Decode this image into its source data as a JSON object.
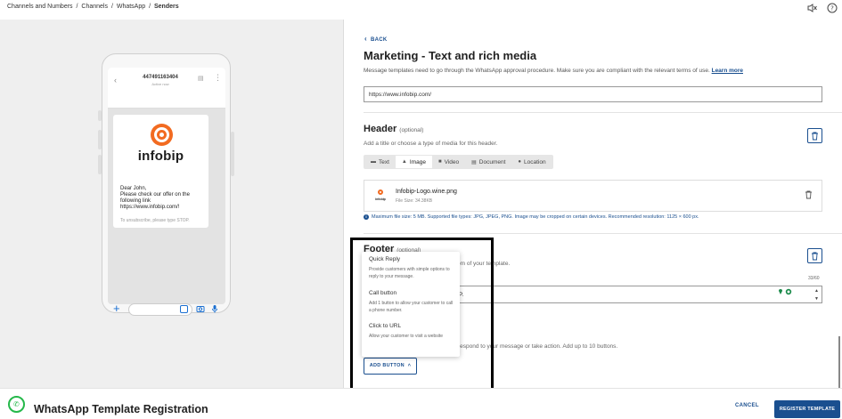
{
  "breadcrumb": {
    "items": [
      "Channels and Numbers",
      "Channels",
      "WhatsApp"
    ],
    "current": "Senders",
    "separator": "/"
  },
  "topbar": {
    "icons": [
      "mute-icon",
      "help-icon"
    ]
  },
  "preview": {
    "phone_number": "447491163404",
    "status": "Active now",
    "logo_text": "infobip",
    "message": "Dear John,\nPlease check our offer on the following link\nhttps://www.infobip.com/!",
    "footer": "To unsubscribe, please type STOP."
  },
  "form": {
    "back_label": "BACK",
    "title": "Marketing - Text and rich media",
    "description": "Message templates need to go through the WhatsApp approval procedure. Make sure you are compliant with the relevant terms of use.",
    "learn_more": "Learn more",
    "url_value": "https://www.infobip.com/",
    "header": {
      "title": "Header",
      "optional": "(optional)",
      "description": "Add a title or choose a type of media for this header.",
      "tabs": [
        "Text",
        "Image",
        "Video",
        "Document",
        "Location"
      ],
      "active_tab": "Image",
      "file_name": "Infobip-Logo.wine.png",
      "file_size": "File Size: 34.38KB",
      "thumb_text": "infobip",
      "info": "Maximum file size: 5 MB. Supported file types: JPG, JPEG, PNG. Image may be cropped on certain devices. Recommended resolution: 1125 × 600 px."
    },
    "footer": {
      "title": "Footer",
      "optional": "(optional)",
      "description_tail": "om of your template.",
      "value_tail": "P.",
      "counter": "33/60"
    },
    "buttons": {
      "description_tail": "respond to your message or take action. Add up to 10 buttons.",
      "add_label": "ADD BUTTON"
    }
  },
  "dropdown": {
    "items": [
      {
        "label": "Quick Reply",
        "desc": "Provide customers with simple options to reply to your message."
      },
      {
        "label": "Call button",
        "desc": "Add 1 button to allow your customer to call a phone number."
      },
      {
        "label": "Click to URL",
        "desc": "Allow your customer to visit a website"
      }
    ]
  },
  "bottombar": {
    "title": "WhatsApp Template Registration",
    "cancel": "CANCEL",
    "register": "REGISTER TEMPLATE"
  },
  "colors": {
    "accent": "#1a4f8f",
    "brand_orange": "#f26b21",
    "whatsapp_green": "#25b84a",
    "highlight": "#000000"
  }
}
